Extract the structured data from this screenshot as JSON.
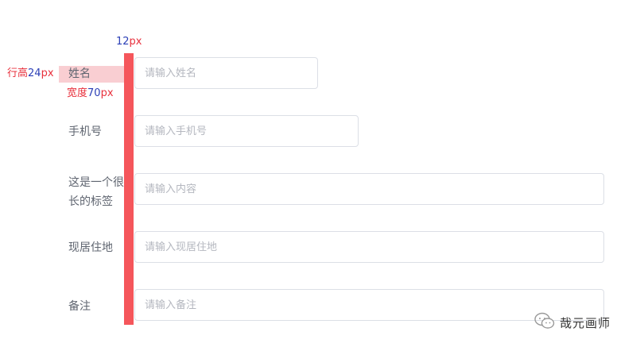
{
  "annotations": {
    "gap_value": "12",
    "gap_unit": "px",
    "line_height_prefix": "行高",
    "line_height_value": "24",
    "line_height_unit": "px",
    "width_prefix": "宽度",
    "width_value": "70",
    "width_unit": "px"
  },
  "colors": {
    "gap_bar": "#f5565b",
    "label_highlight": "#f9ced2",
    "annotation_number": "#2b3fb6",
    "annotation_text": "#e8303c"
  },
  "form": {
    "fields": [
      {
        "label": "姓名",
        "placeholder": "请输入姓名"
      },
      {
        "label": "手机号",
        "placeholder": "请输入手机号"
      },
      {
        "label": "这是一个很长的标签",
        "placeholder": "请输入内容"
      },
      {
        "label": "现居住地",
        "placeholder": "请输入现居住地"
      },
      {
        "label": "备注",
        "placeholder": "请输入备注"
      }
    ]
  },
  "watermark": {
    "icon": "wechat-icon",
    "text": "哉元画师"
  }
}
